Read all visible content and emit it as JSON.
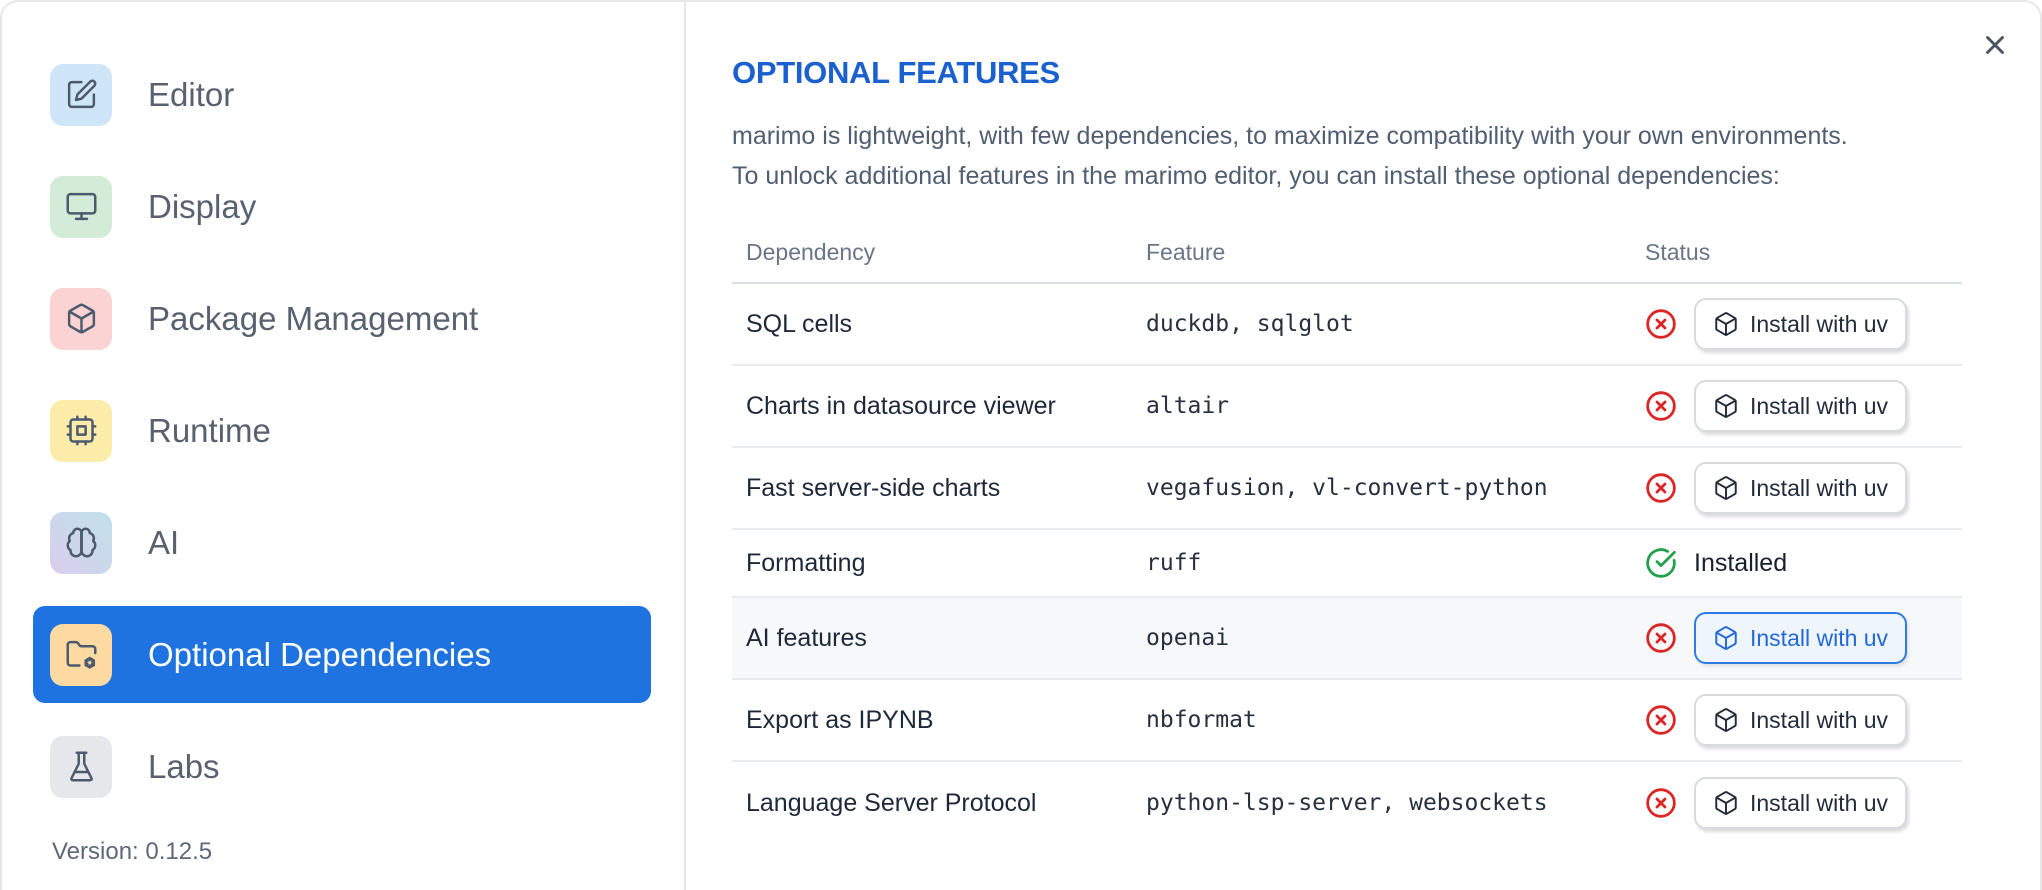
{
  "sidebar": {
    "items": [
      {
        "label": "Editor",
        "icon": "square-pen",
        "icon_bg": "#cfe6f9",
        "selected": false
      },
      {
        "label": "Display",
        "icon": "monitor",
        "icon_bg": "#d3ecd8",
        "selected": false
      },
      {
        "label": "Package Management",
        "icon": "package",
        "icon_bg": "#fbd3d3",
        "selected": false
      },
      {
        "label": "Runtime",
        "icon": "cpu",
        "icon_bg": "#fcecaa",
        "selected": false
      },
      {
        "label": "AI",
        "icon": "brain",
        "icon_bg": "linear-gradient(45deg, #d9cdec 0%, #bfe2ec 100%)",
        "selected": false
      },
      {
        "label": "Optional Dependencies",
        "icon": "folder-cog",
        "icon_bg": "#fcdaa2",
        "selected": true
      },
      {
        "label": "Labs",
        "icon": "flask",
        "icon_bg": "#e6e7ea",
        "selected": false
      }
    ],
    "version_label": "Version: 0.12.5"
  },
  "panel": {
    "title": "OPTIONAL FEATURES",
    "description_line1": "marimo is lightweight, with few dependencies, to maximize compatibility with your own environments.",
    "description_line2": "To unlock additional features in the marimo editor, you can install these optional dependencies:",
    "close_icon": "x-icon",
    "table": {
      "columns": [
        "Dependency",
        "Feature",
        "Status"
      ],
      "rows": [
        {
          "dependency": "SQL cells",
          "feature": "duckdb, sqlglot",
          "status": "missing",
          "action_label": "Install with uv",
          "highlighted": false
        },
        {
          "dependency": "Charts in datasource viewer",
          "feature": "altair",
          "status": "missing",
          "action_label": "Install with uv",
          "highlighted": false
        },
        {
          "dependency": "Fast server-side charts",
          "feature": "vegafusion, vl-convert-python",
          "status": "missing",
          "action_label": "Install with uv",
          "highlighted": false
        },
        {
          "dependency": "Formatting",
          "feature": "ruff",
          "status": "installed",
          "status_label": "Installed",
          "highlighted": false
        },
        {
          "dependency": "AI features",
          "feature": "openai",
          "status": "missing",
          "action_label": "Install with uv",
          "highlighted": true
        },
        {
          "dependency": "Export as IPYNB",
          "feature": "nbformat",
          "status": "missing",
          "action_label": "Install with uv",
          "highlighted": false
        },
        {
          "dependency": "Language Server Protocol",
          "feature": "python-lsp-server, websockets",
          "status": "missing",
          "action_label": "Install with uv",
          "highlighted": false
        }
      ]
    }
  },
  "colors": {
    "selected_item_bg": "#1e73e0",
    "title_blue": "#1b60cf",
    "status_missing_red": "#dc2626",
    "status_installed_green": "#22a04b",
    "primary_button_border": "#2e7ce2",
    "primary_button_text": "#2268d8",
    "primary_button_bg": "#eef5fd",
    "highlight_row_bg": "#f7f8fa"
  }
}
